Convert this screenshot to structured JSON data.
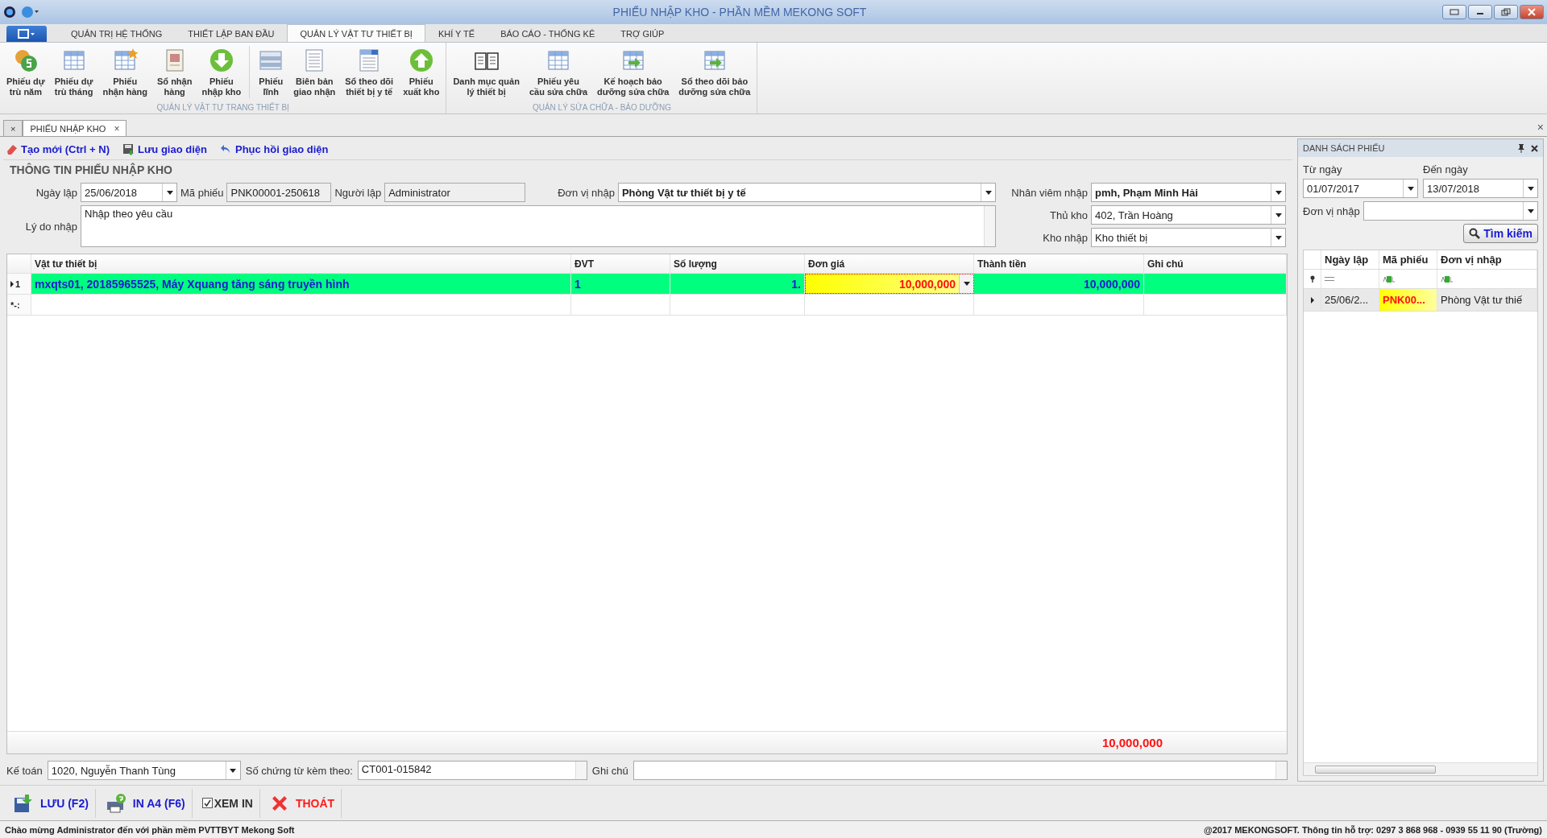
{
  "window": {
    "title": "PHIẾU NHẬP KHO - PHẦN MỀM MEKONG SOFT"
  },
  "ribbon_tabs": [
    {
      "label": "QUẢN TRỊ HỆ THỐNG",
      "selected": false
    },
    {
      "label": "THIẾT LẬP BAN ĐẦU",
      "selected": false
    },
    {
      "label": "QUẢN LÝ VẬT TƯ THIẾT BỊ",
      "selected": true
    },
    {
      "label": "KHÍ Y TẾ",
      "selected": false
    },
    {
      "label": "BÁO CÁO - THỐNG KÊ",
      "selected": false
    },
    {
      "label": "TRỢ GIÚP",
      "selected": false
    }
  ],
  "ribbon_groups": [
    {
      "label": "QUẢN LÝ VẬT TƯ TRANG THIẾT BỊ",
      "items": [
        {
          "label": "Phiếu dự\ntrù năm",
          "kind": "coins"
        },
        {
          "label": "Phiếu dự\ntrù tháng",
          "kind": "table"
        },
        {
          "label": "Phiếu\nnhận hàng",
          "kind": "table-star"
        },
        {
          "label": "Sổ nhận\nhàng",
          "kind": "document"
        },
        {
          "label": "Phiếu\nnhập kho",
          "kind": "arrow-down"
        },
        {
          "label": "Phiếu\nlĩnh",
          "kind": "form",
          "separator": true
        },
        {
          "label": "Biên bản\ngiao nhận",
          "kind": "page"
        },
        {
          "label": "Sổ theo dõi\nthiết bị y tế",
          "kind": "doc-list"
        },
        {
          "label": "Phiếu\nxuất kho",
          "kind": "arrow-up"
        }
      ]
    },
    {
      "label": "QUẢN LÝ SỬA CHỮA - BẢO DƯỠNG",
      "items": [
        {
          "label": "Danh mục quản\nlý thiết bị",
          "kind": "book"
        },
        {
          "label": "Phiếu yêu\ncầu sửa chữa",
          "kind": "table"
        },
        {
          "label": "Kế hoạch bảo\ndưỡng sửa chữa",
          "kind": "table-arrow"
        },
        {
          "label": "Sổ theo dõi bảo\ndưỡng sửa chữa",
          "kind": "table-arrow"
        }
      ]
    }
  ],
  "doc_tabs": [
    {
      "label": "×",
      "selected": false
    },
    {
      "label": "PHIẾU NHẬP KHO",
      "selected": true,
      "close": "×"
    }
  ],
  "doc_close": "×",
  "toolbar": [
    {
      "label": "Tạo mới (Ctrl + N)",
      "kind": "eraser"
    },
    {
      "label": "Lưu giao diện",
      "kind": "save"
    },
    {
      "label": "Phục hồi giao diện",
      "kind": "undo"
    }
  ],
  "section_title": "THÔNG TIN PHIẾU NHẬP KHO",
  "form": {
    "ngay_lap": {
      "label": "Ngày lập",
      "value": "25/06/2018",
      "kind": "combo"
    },
    "ma_phieu": {
      "label": "Mã phiếu",
      "value": "PNK00001-250618",
      "kind": "readonly"
    },
    "nguoi_lap": {
      "label": "Người lập",
      "value": "Administrator",
      "kind": "readonly"
    },
    "don_vi_nhap": {
      "label": "Đơn vị nhập",
      "value": "Phòng Vật tư thiết bị y tế",
      "kind": "combo",
      "bold": true
    },
    "ly_do_nhap": {
      "label": "Lý do nhập",
      "value": "Nhập theo yêu cầu",
      "kind": "memo"
    },
    "nhan_vien_nhap": {
      "label": "Nhân viêm nhập",
      "value": "pmh, Phạm Minh Hải",
      "kind": "combo",
      "bold": true
    },
    "thu_kho": {
      "label": "Thủ kho",
      "value": "402, Trần Hoàng",
      "kind": "combo"
    },
    "kho_nhap": {
      "label": "Kho nhập",
      "value": "Kho thiết bị",
      "kind": "combo"
    }
  },
  "table": {
    "columns": [
      "Vật tư thiết bị",
      "ĐVT",
      "Số lượng",
      "Đơn giá",
      "Thành tiền",
      "Ghi chú"
    ],
    "rows": [
      {
        "indicator": "1",
        "selected": true,
        "cells": [
          {
            "text": "mxqts01, 20185965525, Máy Xquang tăng sáng truyền hình",
            "focused": false
          },
          {
            "text": "1",
            "focused": false
          },
          {
            "text": "1.",
            "focused": false
          },
          {
            "text": "10,000,000",
            "focused": true
          },
          {
            "text": "10,000,000",
            "focused": false
          }
        ]
      }
    ],
    "new_row_indicator": "*-:",
    "total": "10,000,000"
  },
  "footer_fields": {
    "ke_toan": {
      "label": "Kế toán",
      "value": "1020, Nguyễn Thanh Tùng",
      "kind": "combo"
    },
    "so_chung_tu": {
      "label": "Số chứng từ kèm theo:",
      "value": "CT001-015842",
      "kind": "memo"
    },
    "ghi_chu": {
      "label": "Ghi chú",
      "kind": "memo"
    }
  },
  "side_panel": {
    "title": "DANH SÁCH PHIẾU",
    "tu_ngay": {
      "label": "Từ ngày",
      "value": "01/07/2017"
    },
    "den_ngay": {
      "label": "Đến ngày",
      "value": "13/07/2018"
    },
    "don_vi_nhap": {
      "label": "Đơn vị nhập"
    },
    "search_button": "Tìm kiếm",
    "columns": [
      "Ngày lập",
      "Mã phiếu",
      "Đơn vị nhập"
    ],
    "rows": [
      {
        "selected": true,
        "cells": [
          "25/06/2...",
          "PNK00...",
          "Phòng Vật tư thiế"
        ]
      }
    ]
  },
  "buttons": [
    {
      "label": "LƯU (F2)",
      "kind": "save"
    },
    {
      "label": "IN A4 (F6)",
      "kind": "print"
    },
    {
      "label": "XEM IN",
      "kind": "checkbox",
      "checked": true
    },
    {
      "label": "THOÁT",
      "kind": "exit"
    }
  ],
  "status_bar": {
    "left": "Chào mừng Administrator đến với phần mềm PVTTBYT Mekong Soft",
    "right": "@2017 MEKONGSOFT. Thông tin hỗ trợ: 0297 3 868 968 - 0939 55 11 90 (Trường)"
  }
}
